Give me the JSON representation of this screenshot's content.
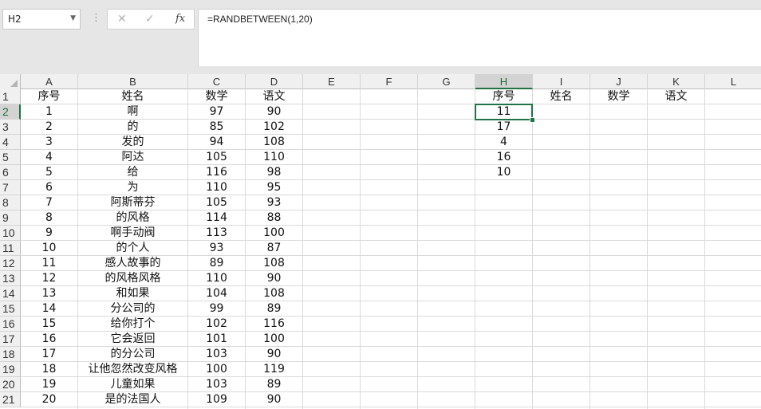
{
  "name_box": "H2",
  "formula": "=RANDBETWEEN(1,20)",
  "columns": [
    "A",
    "B",
    "C",
    "D",
    "E",
    "F",
    "G",
    "H",
    "I",
    "J",
    "K",
    "L"
  ],
  "rows": [
    "1",
    "2",
    "3",
    "4",
    "5",
    "6",
    "7",
    "8",
    "9",
    "10",
    "11",
    "12",
    "13",
    "14",
    "15",
    "16",
    "17",
    "18",
    "19",
    "20",
    "21"
  ],
  "headers": {
    "A": "序号",
    "B": "姓名",
    "C": "数学",
    "D": "语文",
    "H": "序号",
    "I": "姓名",
    "J": "数学",
    "K": "语文"
  },
  "table": [
    [
      "1",
      "啊",
      "97",
      "90"
    ],
    [
      "2",
      "的",
      "85",
      "102"
    ],
    [
      "3",
      "发的",
      "94",
      "108"
    ],
    [
      "4",
      "阿达",
      "105",
      "110"
    ],
    [
      "5",
      "给",
      "116",
      "98"
    ],
    [
      "6",
      "为",
      "110",
      "95"
    ],
    [
      "7",
      "阿斯蒂芬",
      "105",
      "93"
    ],
    [
      "8",
      "的风格",
      "114",
      "88"
    ],
    [
      "9",
      "啊手动阀",
      "113",
      "100"
    ],
    [
      "10",
      "的个人",
      "93",
      "87"
    ],
    [
      "11",
      "感人故事的",
      "89",
      "108"
    ],
    [
      "12",
      "的风格风格",
      "110",
      "90"
    ],
    [
      "13",
      "和如果",
      "104",
      "108"
    ],
    [
      "14",
      "分公司的",
      "99",
      "89"
    ],
    [
      "15",
      "给你打个",
      "102",
      "116"
    ],
    [
      "16",
      "它会返回",
      "101",
      "100"
    ],
    [
      "17",
      "的分公司",
      "103",
      "90"
    ],
    [
      "18",
      "让他忽然改变风格",
      "100",
      "119"
    ],
    [
      "19",
      "儿童如果",
      "103",
      "89"
    ],
    [
      "20",
      "是的法国人",
      "109",
      "90"
    ]
  ],
  "h_values": [
    "11",
    "17",
    "4",
    "16",
    "10"
  ],
  "icons": {
    "cancel": "close-icon",
    "enter": "check-icon",
    "fx": "fx-icon",
    "menu": "kebab-icon",
    "dropdown": "chevron-down-icon"
  },
  "accent": "#217346"
}
